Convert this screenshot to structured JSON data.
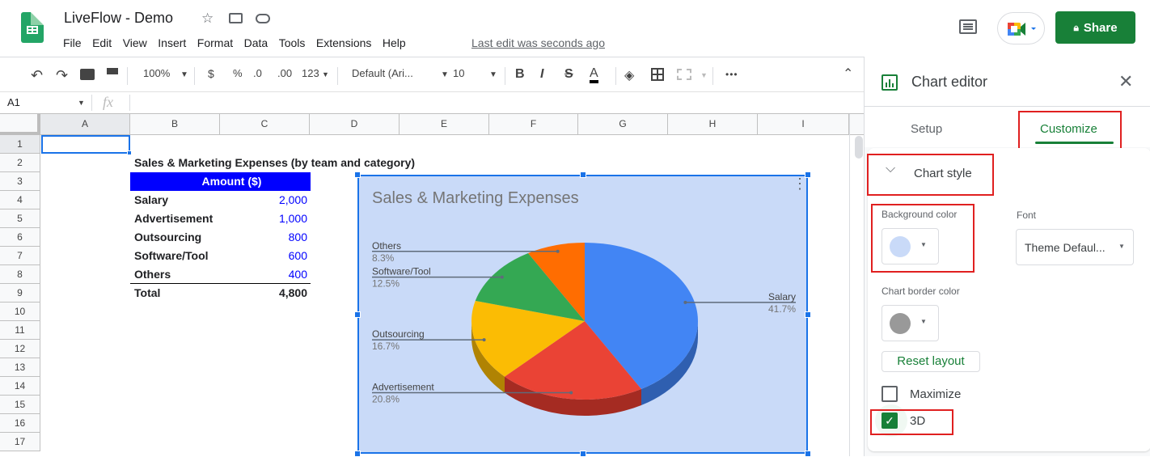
{
  "app": {
    "title": "LiveFlow - Demo",
    "menu": [
      "File",
      "Edit",
      "View",
      "Insert",
      "Format",
      "Data",
      "Tools",
      "Extensions",
      "Help"
    ],
    "last_edit": "Last edit was seconds ago",
    "share_label": "Share"
  },
  "toolbar": {
    "zoom": "100%",
    "currency": "$",
    "percent": "%",
    "dec_decrease": ".0",
    "dec_increase": ".00",
    "more_formats": "123",
    "font": "Default (Ari...",
    "font_size": "10",
    "bold": "B",
    "italic": "I",
    "strike": "S",
    "text_color": "A",
    "more": "•••"
  },
  "formula_bar": {
    "cell_ref": "A1",
    "fx": "fx",
    "value": ""
  },
  "grid": {
    "columns": [
      "A",
      "B",
      "C",
      "D",
      "E",
      "F",
      "G",
      "H",
      "I"
    ],
    "rows": [
      "1",
      "2",
      "3",
      "4",
      "5",
      "6",
      "7",
      "8",
      "9",
      "10",
      "11",
      "12",
      "13",
      "14",
      "15",
      "16",
      "17"
    ]
  },
  "table": {
    "title": "Sales & Marketing Expenses (by team and category)",
    "header": "Amount ($)",
    "rows": [
      {
        "label": "Salary",
        "value": "2,000"
      },
      {
        "label": "Advertisement",
        "value": "1,000"
      },
      {
        "label": "Outsourcing",
        "value": "800"
      },
      {
        "label": "Software/Tool",
        "value": "600"
      },
      {
        "label": "Others",
        "value": "400"
      }
    ],
    "total_label": "Total",
    "total_value": "4,800"
  },
  "chart_data": {
    "type": "pie",
    "title": "Sales & Marketing Expenses",
    "is_3d": true,
    "background_color": "#c9daf8",
    "categories": [
      "Salary",
      "Advertisement",
      "Outsourcing",
      "Software/Tool",
      "Others"
    ],
    "values": [
      2000,
      1000,
      800,
      600,
      400
    ],
    "percent_labels": [
      "41.7%",
      "20.8%",
      "16.7%",
      "12.5%",
      "8.3%"
    ],
    "colors": [
      "#4285f4",
      "#ea4335",
      "#fbbc04",
      "#34a853",
      "#ff6d01"
    ],
    "side_colors": [
      "#2f5fb0",
      "#a52b22",
      "#b08303",
      "#24773a",
      "#b54d00"
    ]
  },
  "panel": {
    "title": "Chart editor",
    "tabs": [
      "Setup",
      "Customize"
    ],
    "active_tab": "Customize",
    "section": "Chart style",
    "bg_color_label": "Background color",
    "bg_color": "#c9daf8",
    "font_label": "Font",
    "font_value": "Theme Defaul...",
    "border_color_label": "Chart border color",
    "border_color": "#999999",
    "reset_label": "Reset layout",
    "maximize_label": "Maximize",
    "maximize_checked": false,
    "threed_label": "3D",
    "threed_checked": true
  }
}
